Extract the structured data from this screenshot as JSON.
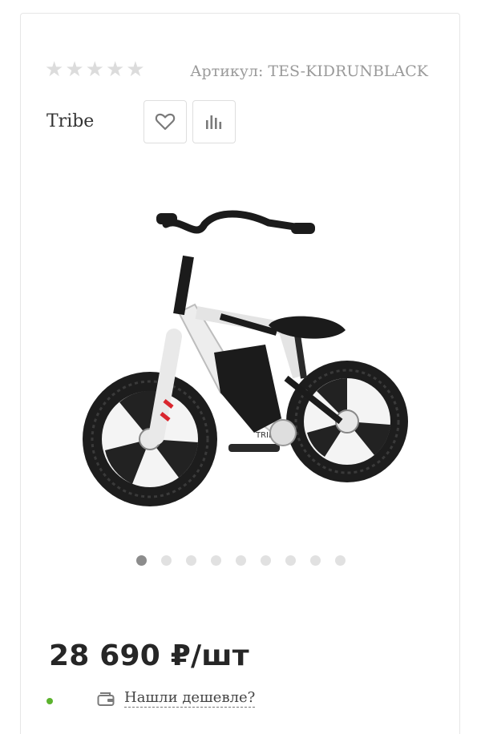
{
  "product": {
    "rating": {
      "value": 0,
      "max": 5
    },
    "sku_text": "Артикул: TES-KIDRUNBLACK",
    "brand": "Tribe",
    "price": "28 690 ₽/шт",
    "find_cheaper": "Нашли дешевле?",
    "frame_text": "TRIBE",
    "in_stock_color": "#5cb32e"
  },
  "icons": {
    "wishlist": "heart-icon",
    "compare": "bar-chart-icon",
    "cheaper": "wallet-icon"
  },
  "gallery": {
    "total": 9,
    "active_index": 0
  }
}
